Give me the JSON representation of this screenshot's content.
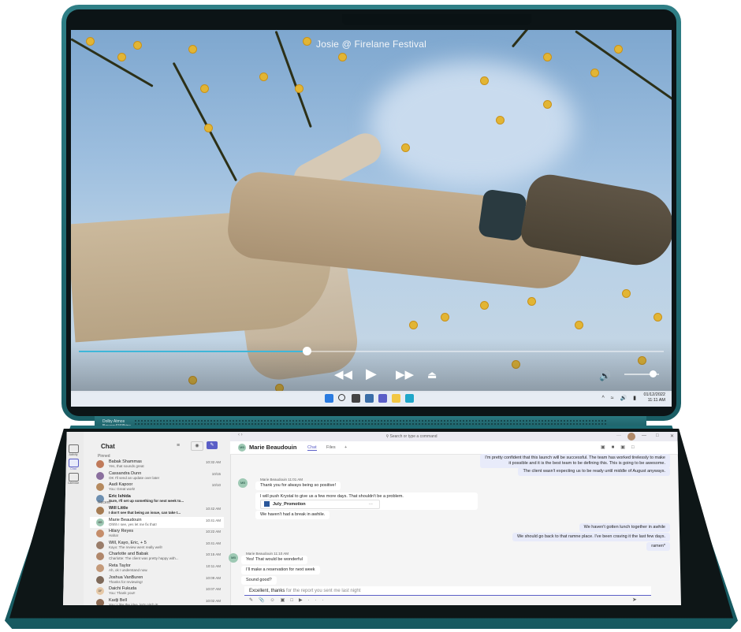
{
  "video": {
    "title": "Josie @ Firelane Festival",
    "progress": 0.39,
    "volume": 0.82
  },
  "device_tag": {
    "line1": "Dolby Atmos",
    "line2": "Bowers&Wilkins"
  },
  "taskbar": {
    "date": "01/12/2022",
    "time": "11:11 AM"
  },
  "teams": {
    "search_placeholder": "Search or type a command",
    "list_title": "Chat",
    "section_pinned": "Pinned",
    "section_recent": "Recent",
    "rail": [
      {
        "label": "Activity",
        "icon": "bell-icon"
      },
      {
        "label": "Chat",
        "icon": "chat-icon"
      },
      {
        "label": "Calendar",
        "icon": "calendar-icon"
      }
    ],
    "pinned": [
      {
        "name": "Babak Shammas",
        "preview": "Yes, that sounds great",
        "time": "10:32 AM",
        "color": "#c07a5a"
      },
      {
        "name": "Cassandra Dunn",
        "preview": "OK I'll send an update over later",
        "time": "10/15",
        "color": "#8a6f9e"
      },
      {
        "name": "Aadi Kapoor",
        "preview": "You: Great work!",
        "time": "10/10",
        "color": "#b58a5f"
      },
      {
        "name": "Eric Ishida",
        "preview": "Sure, I'll set up something for next week to...",
        "time": "",
        "color": "#6d8fb0"
      }
    ],
    "recent": [
      {
        "name": "Will Little",
        "preview": "I don't see that being an issue, can take t...",
        "time": "10:42 AM",
        "color": "#a57b52"
      },
      {
        "name": "Marie Beaudouin",
        "preview": "Ohhh I see, yes let me fix that!",
        "time": "10:41 AM",
        "color": "#9ec9b4",
        "initials": "MB"
      },
      {
        "name": "Hilary Reyes",
        "preview": "Haha!",
        "time": "10:22 AM",
        "color": "#c58d6a"
      },
      {
        "name": "Will, Kayo, Eric, + 5",
        "preview": "Kayo: The review went really well!",
        "time": "10:41 AM",
        "color": "#9a7d6a"
      },
      {
        "name": "Charlotte and Babak",
        "preview": "Charlotte: The client was pretty happy with...",
        "time": "10:15 AM",
        "color": "#b0876b"
      },
      {
        "name": "Reta Taylor",
        "preview": "Ah, ok I understand now.",
        "time": "10:11 AM",
        "color": "#c49a7a"
      },
      {
        "name": "Joshua VanBuren",
        "preview": "Thanks for reviewing!",
        "time": "10:09 AM",
        "color": "#7f6a5a"
      },
      {
        "name": "Daichi Fukuda",
        "preview": "You: Thank you!!",
        "time": "10:07 AM",
        "color": "#e6c9a8",
        "initials": "DF"
      },
      {
        "name": "Kadji Bell",
        "preview": "You: I like the idea, let's pitch it!",
        "time": "10:02 AM",
        "color": "#8d6b54"
      }
    ],
    "conversation": {
      "name": "Marie Beaudouin",
      "initials": "MB",
      "tabs": [
        "Chat",
        "Files"
      ],
      "add_tab": "+",
      "me_block1": [
        "I'm pretty confident that this launch will be successful. The team has worked tirelessly to make",
        "it possible and it is the best team to be defining this. This is going to be awesome.",
        "The client wasn't expecting us to be ready until middle of August anyways."
      ],
      "them1_meta": "Marie Beaudouin   11:01 AM",
      "them1_msg1": "Thank you for always being so positive!",
      "them1_msg2": "I will push Krystal to give us a few more days. That shouldn't be a problem.",
      "file_name": "July_Promotion",
      "file_more": "···",
      "them1_msg3": "We haven't had a break in awhile.",
      "me_block2": [
        "We haven't gotten lunch together in awhile",
        "We should go back to that ramne place. I've been craving it the last few days.",
        "ramen*"
      ],
      "them2_meta": "Marie Beaudouin   11:10 AM",
      "them2_msg1": "Yes! That would be wonderful",
      "them2_msg2": "I'll make a reservation for next week",
      "them2_msg3": "Sound good?"
    },
    "compose": {
      "typed": "Excellent, thanks",
      "tail": " for the report you sent me last night"
    }
  }
}
